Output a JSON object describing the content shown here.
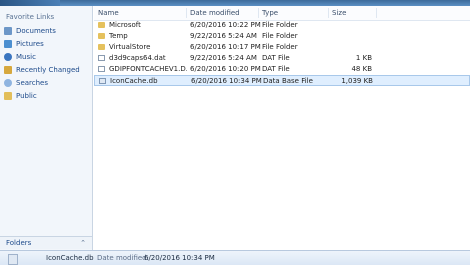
{
  "nav": {
    "title": "Favorite Links",
    "items": [
      {
        "label": "Documents",
        "icon": "documents-icon"
      },
      {
        "label": "Pictures",
        "icon": "pictures-icon"
      },
      {
        "label": "Music",
        "icon": "music-icon"
      },
      {
        "label": "Recently Changed",
        "icon": "recently-changed-icon"
      },
      {
        "label": "Searches",
        "icon": "searches-icon"
      },
      {
        "label": "Public",
        "icon": "public-icon"
      }
    ],
    "folders_label": "Folders"
  },
  "columns": {
    "name": "Name",
    "date": "Date modified",
    "type": "Type",
    "size": "Size"
  },
  "files": [
    {
      "name": "Microsoft",
      "date": "6/20/2016 10:22 PM",
      "type": "File Folder",
      "size": "",
      "icon": "folder-icon"
    },
    {
      "name": "Temp",
      "date": "9/22/2016 5:24 AM",
      "type": "File Folder",
      "size": "",
      "icon": "folder-icon"
    },
    {
      "name": "VirtualStore",
      "date": "6/20/2016 10:17 PM",
      "type": "File Folder",
      "size": "",
      "icon": "folder-icon"
    },
    {
      "name": "d3d9caps64.dat",
      "date": "9/22/2016 5:24 AM",
      "type": "DAT File",
      "size": "1 KB",
      "icon": "file-icon"
    },
    {
      "name": "GDIPFONTCACHEV1.D...",
      "date": "6/20/2016 10:20 PM",
      "type": "DAT File",
      "size": "48 KB",
      "icon": "file-icon"
    },
    {
      "name": "IconCache.db",
      "date": "6/20/2016 10:34 PM",
      "type": "Data Base File",
      "size": "1,039 KB",
      "icon": "database-file-icon",
      "selected": true
    }
  ],
  "details": {
    "filename": "IconCache.db",
    "modified_label": "Date modified:",
    "modified_value": "6/20/2016 10:34 PM"
  }
}
